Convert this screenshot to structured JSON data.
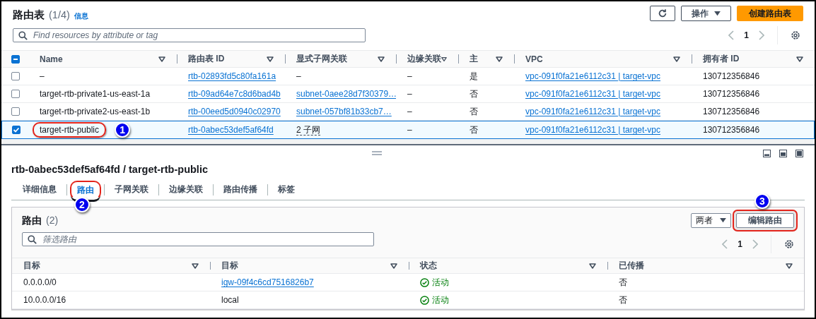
{
  "route_tables": {
    "title": "路由表",
    "count": "(1/4)",
    "info_link": "信息",
    "actions_button": "操作",
    "create_button": "创建路由表",
    "search": {
      "placeholder": "Find resources by attribute or tag"
    },
    "page": "1",
    "select_all_indeterminate": true,
    "columns": [
      "Name",
      "路由表 ID",
      "显式子网关联",
      "边缘关联",
      "主",
      "VPC",
      "拥有者 ID"
    ],
    "rows": [
      {
        "selected": false,
        "cells": [
          {
            "text": "–"
          },
          {
            "text": "rtb-02893fd5c80fa161a",
            "kind": "link"
          },
          {
            "text": "–"
          },
          {
            "text": "–"
          },
          {
            "text": "是"
          },
          {
            "text": "vpc-091f0fa21e6112c31 | target-vpc",
            "kind": "link"
          },
          {
            "text": "130712356846"
          }
        ]
      },
      {
        "selected": false,
        "cells": [
          {
            "text": "target-rtb-private1-us-east-1a"
          },
          {
            "text": "rtb-09ad64e7c8d6bad4b",
            "kind": "link"
          },
          {
            "text": "subnet-0aee28d7f30379…",
            "kind": "link"
          },
          {
            "text": "–"
          },
          {
            "text": "否"
          },
          {
            "text": "vpc-091f0fa21e6112c31 | target-vpc",
            "kind": "link"
          },
          {
            "text": "130712356846"
          }
        ]
      },
      {
        "selected": false,
        "cells": [
          {
            "text": "target-rtb-private2-us-east-1b"
          },
          {
            "text": "rtb-00eed5d0940c02970",
            "kind": "link"
          },
          {
            "text": "subnet-057bf81b33cb7…",
            "kind": "link"
          },
          {
            "text": "–"
          },
          {
            "text": "否"
          },
          {
            "text": "vpc-091f0fa21e6112c31 | target-vpc",
            "kind": "link"
          },
          {
            "text": "130712356846"
          }
        ]
      },
      {
        "selected": true,
        "cells": [
          {
            "text": "target-rtb-public",
            "callout": "1"
          },
          {
            "text": "rtb-0abec53def5af64fd",
            "kind": "link"
          },
          {
            "text": "2 子网",
            "kind": "dotted"
          },
          {
            "text": "–"
          },
          {
            "text": "否"
          },
          {
            "text": "vpc-091f0fa21e6112c31 | target-vpc",
            "kind": "link"
          },
          {
            "text": "130712356846"
          }
        ]
      }
    ]
  },
  "detail": {
    "title": "rtb-0abec53def5af64fd / target-rtb-public",
    "tabs": [
      {
        "label": "详细信息",
        "selected": false
      },
      {
        "label": "路由",
        "selected": true,
        "callout": "2"
      },
      {
        "label": "子网关联",
        "selected": false
      },
      {
        "label": "边缘关联",
        "selected": false
      },
      {
        "label": "路由传播",
        "selected": false
      },
      {
        "label": "标签",
        "selected": false
      }
    ],
    "routes": {
      "title": "路由",
      "count": "(2)",
      "filter_select": "两者",
      "edit_button": {
        "label": "编辑路由",
        "callout": "3"
      },
      "search": {
        "placeholder": "筛选路由"
      },
      "page": "1",
      "columns": [
        "目标",
        "目标",
        "状态",
        "已传播"
      ],
      "rows": [
        {
          "destination": "0.0.0.0/0",
          "target": {
            "text": "igw-09f4c6cd7516826b7",
            "kind": "link"
          },
          "status": {
            "text": "活动",
            "kind": "success"
          },
          "propagated": "否"
        },
        {
          "destination": "10.0.0.0/16",
          "target": {
            "text": "local",
            "kind": "text"
          },
          "status": {
            "text": "活动",
            "kind": "success"
          },
          "propagated": "否"
        }
      ]
    }
  }
}
